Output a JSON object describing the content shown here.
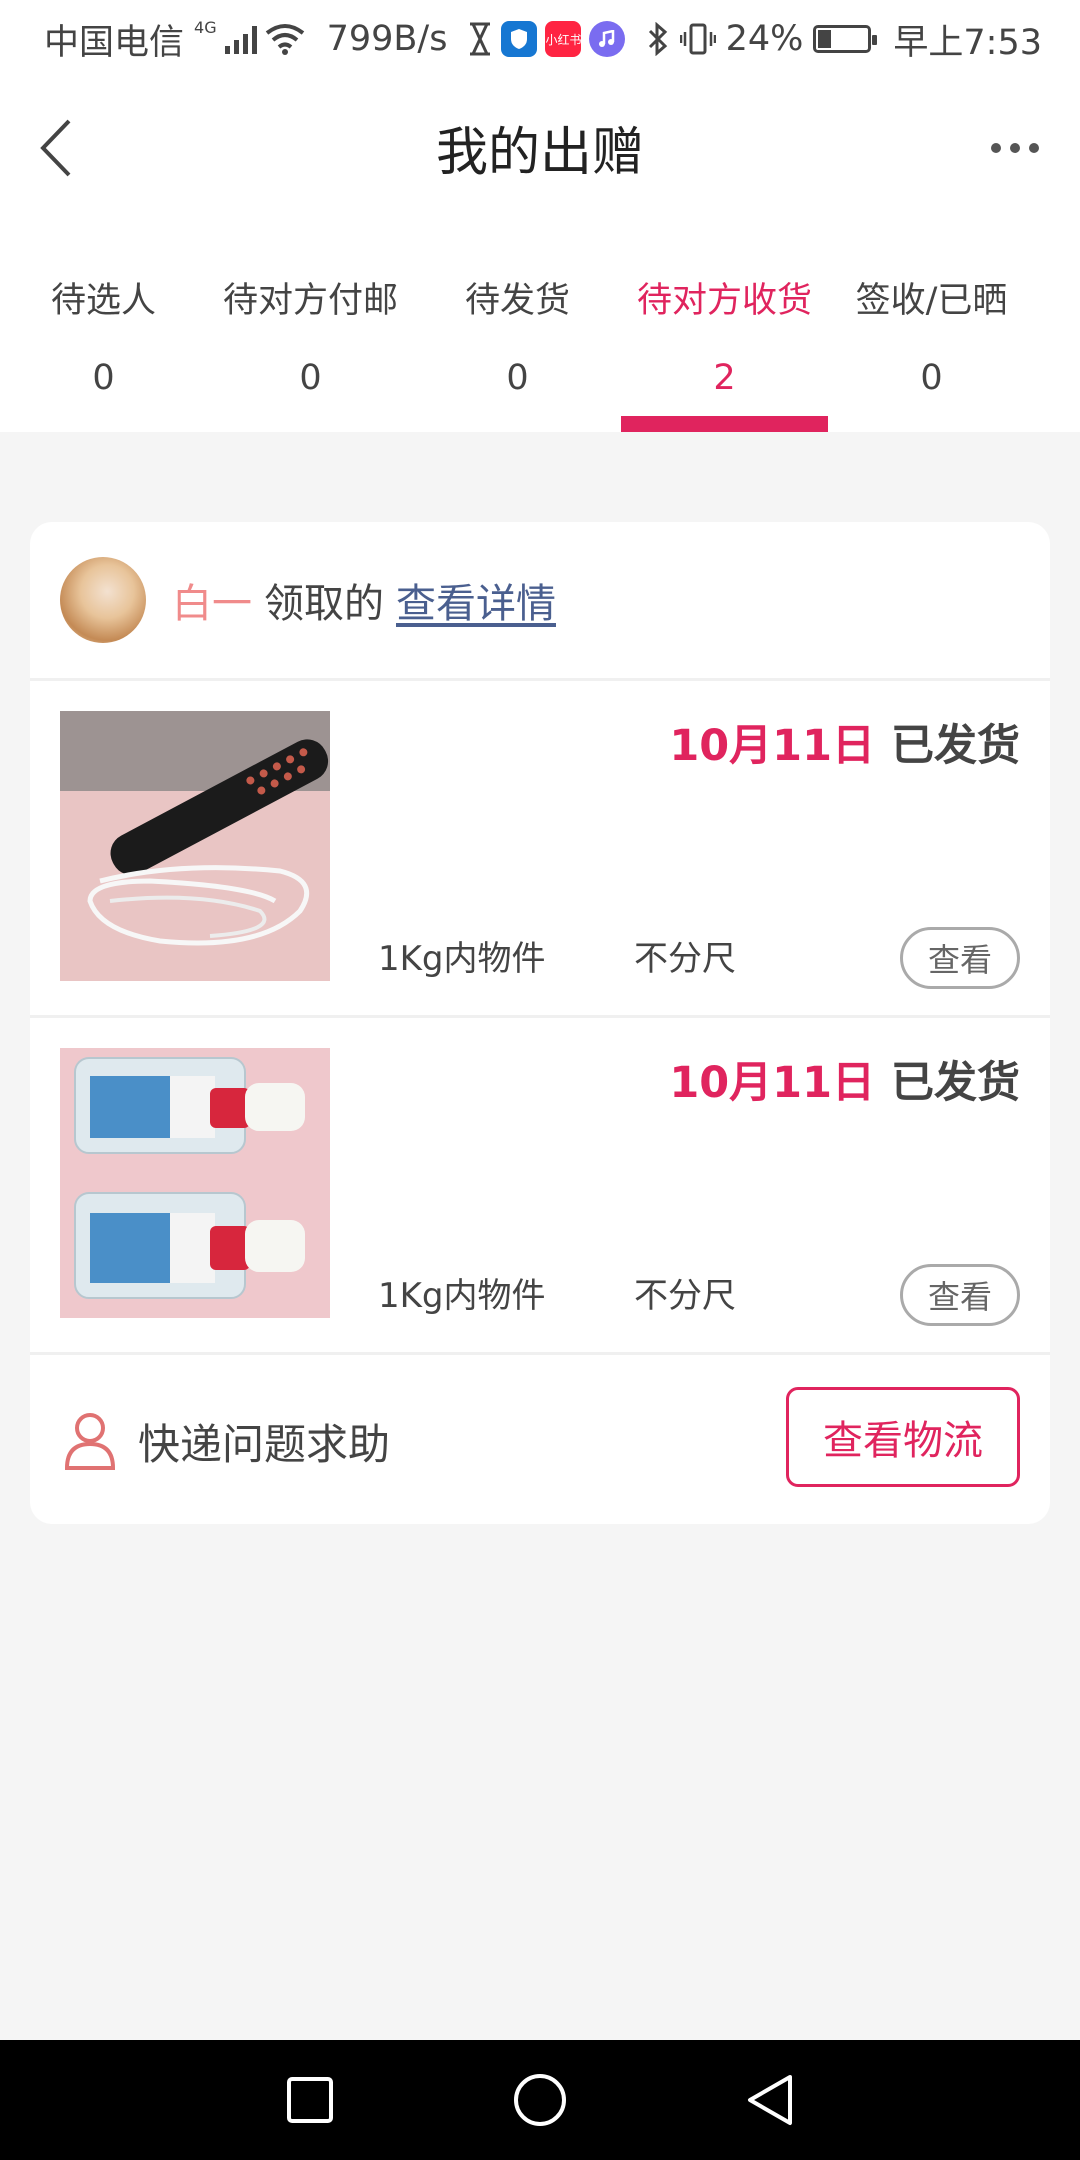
{
  "status_bar": {
    "carrier": "中国电信",
    "network": "4G",
    "speed": "799B/s",
    "app_badge": "小红书",
    "battery": "24%",
    "time": "早上7:53"
  },
  "header": {
    "title": "我的出赠"
  },
  "tabs": [
    {
      "label": "待选人",
      "count": "0"
    },
    {
      "label": "待对方付邮",
      "count": "0"
    },
    {
      "label": "待发货",
      "count": "0"
    },
    {
      "label": "待对方收货",
      "count": "2",
      "active": true
    },
    {
      "label": "签收/已晒",
      "count": "0"
    }
  ],
  "card": {
    "receiver_name": "白一",
    "received_text": "领取的",
    "detail_link": "查看详情",
    "items": [
      {
        "date": "10月11日",
        "status": "已发货",
        "weight": "1Kg内物件",
        "size": "不分尺",
        "button": "查看",
        "image_icon": "hair-straightener-brush-photo"
      },
      {
        "date": "10月11日",
        "status": "已发货",
        "weight": "1Kg内物件",
        "size": "不分尺",
        "button": "查看",
        "image_icon": "bottles-photo"
      }
    ],
    "footer": {
      "help_text": "快递问题求助",
      "logistics_button": "查看物流"
    }
  },
  "colors": {
    "accent": "#e0245e",
    "link": "#4a5f8f",
    "name": "#f08b8b"
  }
}
